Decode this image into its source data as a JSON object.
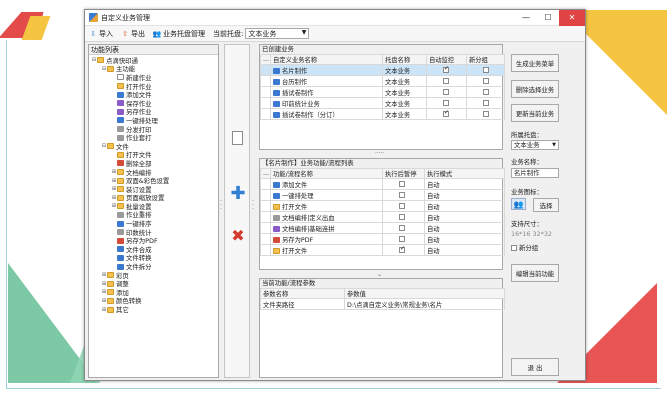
{
  "window": {
    "title": "自定义业务管理"
  },
  "toolbar": {
    "import": "导入",
    "export": "导出",
    "host": "业务托盘管理",
    "current_tray_label": "当前托盘:",
    "current_tray_value": "文本业务"
  },
  "left": {
    "header": "功能列表",
    "tree": [
      {
        "indent": 0,
        "tw": "⊟",
        "icon": "folder",
        "label": "点滴快印通"
      },
      {
        "indent": 1,
        "tw": "⊟",
        "icon": "folder",
        "label": "主功能"
      },
      {
        "indent": 2,
        "tw": "",
        "icon": "doc",
        "label": "新建作业"
      },
      {
        "indent": 2,
        "tw": "",
        "icon": "folder",
        "label": "打开作业"
      },
      {
        "indent": 2,
        "tw": "",
        "icon": "blue",
        "label": "添加文件"
      },
      {
        "indent": 2,
        "tw": "",
        "icon": "purple",
        "label": "保存作业"
      },
      {
        "indent": 2,
        "tw": "",
        "icon": "purple",
        "label": "另存作业"
      },
      {
        "indent": 2,
        "tw": "",
        "icon": "blue",
        "label": "一键排处理"
      },
      {
        "indent": 2,
        "tw": "",
        "icon": "gray",
        "label": "分发打印"
      },
      {
        "indent": 2,
        "tw": "",
        "icon": "gray",
        "label": "作业套打"
      },
      {
        "indent": 1,
        "tw": "⊟",
        "icon": "folder",
        "label": "文件"
      },
      {
        "indent": 2,
        "tw": "",
        "icon": "folder",
        "label": "打开文件"
      },
      {
        "indent": 2,
        "tw": "",
        "icon": "red",
        "label": "删除全部"
      },
      {
        "indent": 2,
        "tw": "⊞",
        "icon": "folder",
        "label": "文档编排"
      },
      {
        "indent": 2,
        "tw": "⊞",
        "icon": "folder",
        "label": "双面&彩色设置"
      },
      {
        "indent": 2,
        "tw": "⊞",
        "icon": "folder",
        "label": "装订设置"
      },
      {
        "indent": 2,
        "tw": "⊞",
        "icon": "folder",
        "label": "页面缩放设置"
      },
      {
        "indent": 2,
        "tw": "⊞",
        "icon": "folder",
        "label": "批量设置"
      },
      {
        "indent": 2,
        "tw": "",
        "icon": "gray",
        "label": "作业重排"
      },
      {
        "indent": 2,
        "tw": "",
        "icon": "blue",
        "label": "一键排序"
      },
      {
        "indent": 2,
        "tw": "",
        "icon": "gray",
        "label": "印数统计"
      },
      {
        "indent": 2,
        "tw": "",
        "icon": "red",
        "label": "另存为PDF"
      },
      {
        "indent": 2,
        "tw": "",
        "icon": "blue",
        "label": "文件合成"
      },
      {
        "indent": 2,
        "tw": "",
        "icon": "blue",
        "label": "文件转换"
      },
      {
        "indent": 2,
        "tw": "",
        "icon": "blue",
        "label": "文件拆分"
      },
      {
        "indent": 1,
        "tw": "⊞",
        "icon": "folder",
        "label": "彩页"
      },
      {
        "indent": 1,
        "tw": "⊞",
        "icon": "folder",
        "label": "调整"
      },
      {
        "indent": 1,
        "tw": "⊞",
        "icon": "folder",
        "label": "添加"
      },
      {
        "indent": 1,
        "tw": "⊞",
        "icon": "folder",
        "label": "颜色转换"
      },
      {
        "indent": 1,
        "tw": "⊞",
        "icon": "folder",
        "label": "其它"
      }
    ]
  },
  "created": {
    "title": "已创建业务",
    "headers": [
      "...",
      "自定义业务名称",
      "托盘名称",
      "自动监控",
      "新分组"
    ],
    "rows": [
      {
        "name": "名片制作",
        "tray": "文本业务",
        "auto": true,
        "group": false,
        "sel": true
      },
      {
        "name": "台历制作",
        "tray": "文本业务",
        "auto": false,
        "group": false,
        "sel": false
      },
      {
        "name": "插试卷制作",
        "tray": "文本业务",
        "auto": false,
        "group": false,
        "sel": false
      },
      {
        "name": "印前统计业务",
        "tray": "文本业务",
        "auto": false,
        "group": false,
        "sel": false
      },
      {
        "name": "插试卷制作（分订）",
        "tray": "文本业务",
        "auto": true,
        "group": false,
        "sel": false
      }
    ]
  },
  "flow": {
    "title": "【名片制作】业务功能/流程列表",
    "headers": [
      "...",
      "功能/流程名称",
      "执行后暂停",
      "执行模式"
    ],
    "rows": [
      {
        "icon": "blue",
        "name": "添加文件",
        "pause": false,
        "mode": "自动"
      },
      {
        "icon": "blue",
        "name": "一键排处理",
        "pause": false,
        "mode": "自动"
      },
      {
        "icon": "folder",
        "name": "打开文件",
        "pause": false,
        "mode": "自动"
      },
      {
        "icon": "gray",
        "name": "文档编排|定义出血",
        "pause": false,
        "mode": "自动"
      },
      {
        "icon": "purple",
        "name": "文档编排|基础连拼",
        "pause": false,
        "mode": "自动"
      },
      {
        "icon": "red",
        "name": "另存为PDF",
        "pause": false,
        "mode": "自动"
      },
      {
        "icon": "folder",
        "name": "打开文件",
        "pause": true,
        "mode": "自动"
      }
    ]
  },
  "params": {
    "title": "当前功能/流程参数",
    "headers": [
      "参数名称",
      "参数值"
    ],
    "rows": [
      {
        "name": "文件夹路径",
        "value": "D:\\点滴自定义业务\\常规业务\\名片"
      }
    ]
  },
  "right": {
    "gen_menu": "生成业务菜单",
    "delete_selected": "删除选择业务",
    "update_current": "更新当前业务",
    "tray_label": "所属托盘：",
    "tray_value": "文本业务",
    "name_label": "业务名称：",
    "name_value": "名片制作",
    "icon_label": "业务图标：",
    "choose": "选择",
    "size_label": "支持尺寸：",
    "size_value": "16*16  32*32",
    "new_group": "新分组",
    "edit_func": "编辑当前功能",
    "exit": "退    出"
  }
}
